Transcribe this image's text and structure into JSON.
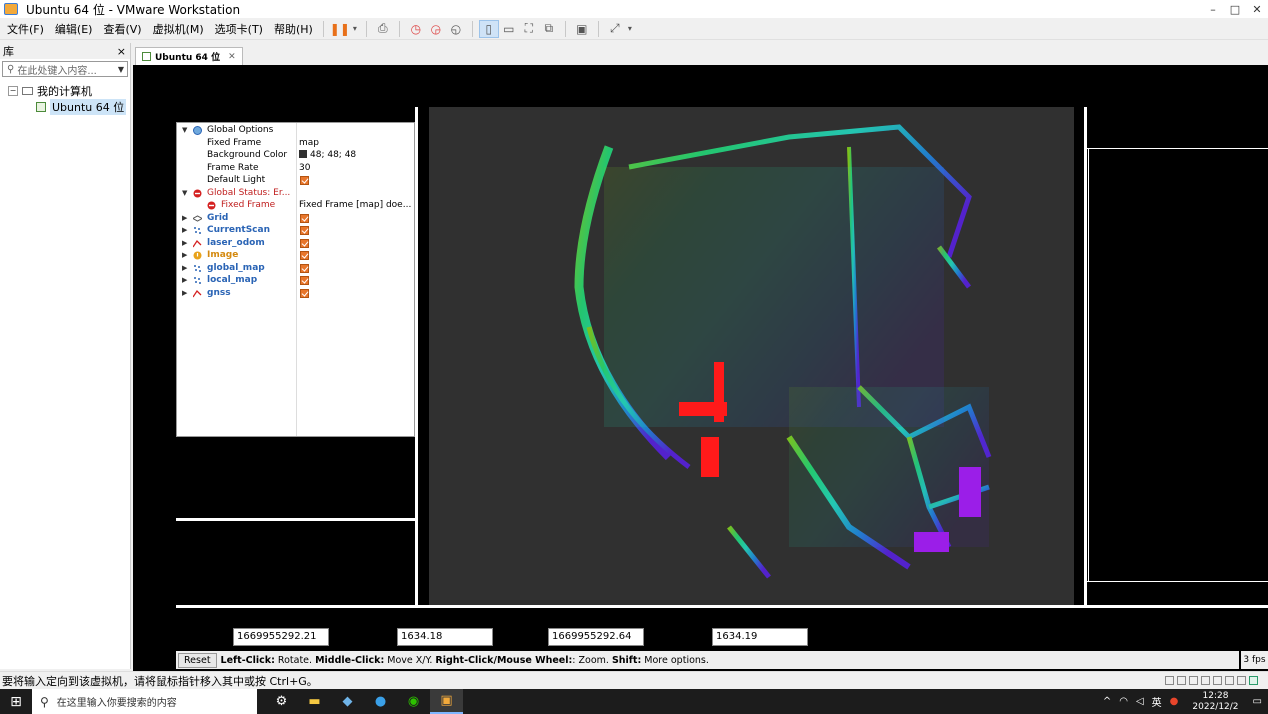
{
  "window": {
    "title": "Ubuntu 64 位 - VMware Workstation",
    "controls": [
      "–",
      "□",
      "✕"
    ]
  },
  "menubar": {
    "items": [
      "文件(F)",
      "编辑(E)",
      "查看(V)",
      "虚拟机(M)",
      "选项卡(T)",
      "帮助(H)"
    ]
  },
  "library": {
    "title": "库",
    "close": "×",
    "search_placeholder": "在此处键入内容...",
    "tree_root": "我的计算机",
    "tree_child": "Ubuntu 64 位"
  },
  "tab": {
    "label": "Ubuntu 64 位",
    "close": "✕"
  },
  "rviz": {
    "displays": [
      {
        "name": "Global Options",
        "value": "",
        "icon": "globe-icon",
        "arrow": "▼",
        "style": "normal"
      },
      {
        "name": "Fixed Frame",
        "value": "map",
        "style": "child"
      },
      {
        "name": "Background Color",
        "value": "48; 48; 48",
        "style": "child",
        "swatch": true
      },
      {
        "name": "Frame Rate",
        "value": "30",
        "style": "child"
      },
      {
        "name": "Default Light",
        "value": "",
        "style": "child",
        "check": true
      },
      {
        "name": "Global Status: Er...",
        "value": "",
        "icon": "error-icon",
        "arrow": "▼",
        "style": "err"
      },
      {
        "name": "Fixed Frame",
        "value": "Fixed Frame [map] doe...",
        "icon": "error-icon",
        "style": "err-child"
      },
      {
        "name": "Grid",
        "value": "",
        "icon": "grid-icon",
        "arrow": "▶",
        "style": "bold",
        "check": true
      },
      {
        "name": "CurrentScan",
        "value": "",
        "icon": "pointcloud-icon",
        "arrow": "▶",
        "style": "bold",
        "check": true
      },
      {
        "name": "laser_odom",
        "value": "",
        "icon": "path-icon",
        "arrow": "▶",
        "style": "bold",
        "check": true
      },
      {
        "name": "Image",
        "value": "",
        "icon": "warning-icon",
        "arrow": "▶",
        "style": "warn",
        "check": true
      },
      {
        "name": "global_map",
        "value": "",
        "icon": "pointcloud-icon",
        "arrow": "▶",
        "style": "bold",
        "check": true
      },
      {
        "name": "local_map",
        "value": "",
        "icon": "pointcloud-icon",
        "arrow": "▶",
        "style": "bold",
        "check": true
      },
      {
        "name": "gnss",
        "value": "",
        "icon": "path-icon",
        "arrow": "▶",
        "style": "bold",
        "check": true
      }
    ],
    "background_color": "#303030",
    "time": {
      "ros_time": "1669955292.21",
      "ros_elapsed": "1634.18",
      "wall_time": "1669955292.64",
      "wall_elapsed": "1634.19"
    },
    "reset_label": "Reset",
    "hint": {
      "left_click_key": "Left-Click:",
      "left_click_desc": " Rotate. ",
      "middle_click_key": "Middle-Click:",
      "middle_click_desc": " Move X/Y. ",
      "right_click_key": "Right-Click/Mouse Wheel:",
      "right_click_desc": ": Zoom. ",
      "shift_key": "Shift:",
      "shift_desc": " More options."
    },
    "fps": "3 fps"
  },
  "status_message": "要将输入定向到该虚拟机，请将鼠标指针移入其中或按 Ctrl+G。",
  "taskbar": {
    "search_placeholder": "在这里输入你要搜索的内容",
    "clock_time": "12:28",
    "clock_date": "2022/12/2",
    "ime": "英"
  }
}
